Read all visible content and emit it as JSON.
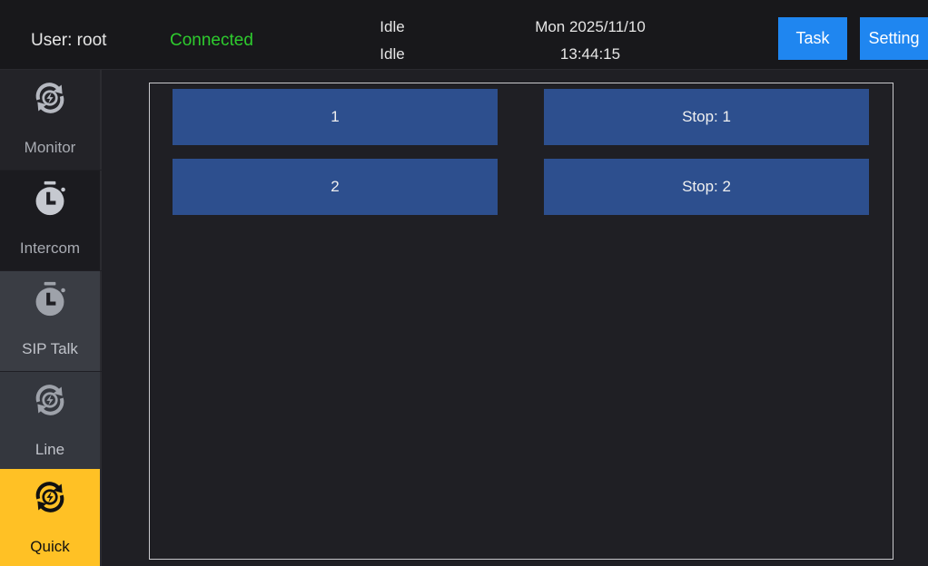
{
  "header": {
    "user_label": "User:  root",
    "connection_status": "Connected",
    "status_lines": [
      "Idle",
      "Idle"
    ],
    "date": "Mon 2025/11/10",
    "time": "13:44:15",
    "task_label": "Task",
    "setting_label": "Setting"
  },
  "colors": {
    "accent": "#1f86f0",
    "connected": "#2ecb2e",
    "active_tab": "#ffc125",
    "quick_button": "#2d4f8e"
  },
  "sidebar": {
    "items": [
      {
        "label": "Monitor",
        "icon": "sync-icon",
        "active": false
      },
      {
        "label": "Intercom",
        "icon": "timer-icon",
        "active": false
      },
      {
        "label": "SIP Talk",
        "icon": "timer-icon",
        "active": false
      },
      {
        "label": "Line",
        "icon": "sync-icon",
        "active": false
      },
      {
        "label": "Quick",
        "icon": "sync-icon",
        "active": true
      }
    ]
  },
  "quick": {
    "buttons": [
      {
        "label": "1"
      },
      {
        "label": "Stop: 1"
      },
      {
        "label": "2"
      },
      {
        "label": "Stop: 2"
      }
    ]
  }
}
